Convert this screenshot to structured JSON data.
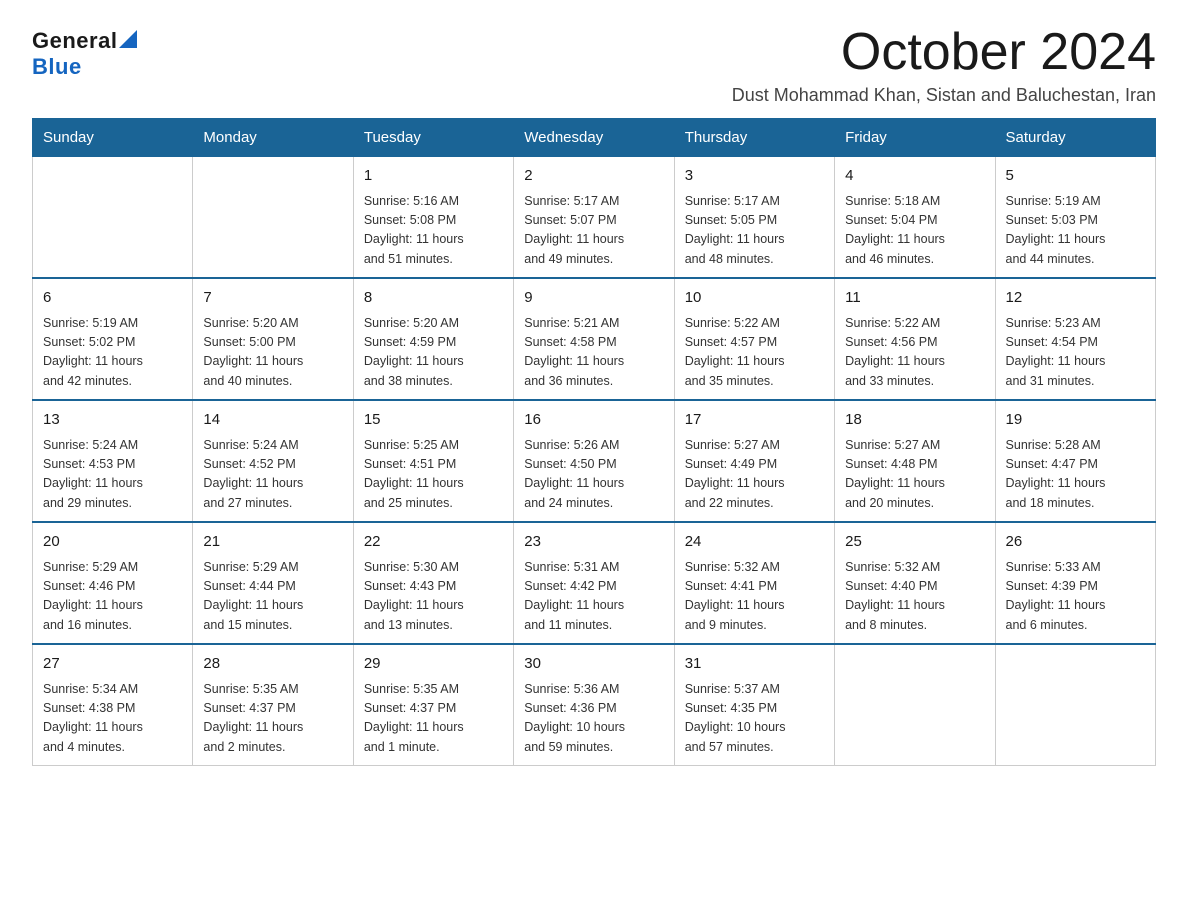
{
  "header": {
    "logo_general": "General",
    "logo_blue": "Blue",
    "month_title": "October 2024",
    "location": "Dust Mohammad Khan, Sistan and Baluchestan, Iran"
  },
  "weekdays": [
    "Sunday",
    "Monday",
    "Tuesday",
    "Wednesday",
    "Thursday",
    "Friday",
    "Saturday"
  ],
  "weeks": [
    [
      {
        "day": "",
        "info": ""
      },
      {
        "day": "",
        "info": ""
      },
      {
        "day": "1",
        "info": "Sunrise: 5:16 AM\nSunset: 5:08 PM\nDaylight: 11 hours\nand 51 minutes."
      },
      {
        "day": "2",
        "info": "Sunrise: 5:17 AM\nSunset: 5:07 PM\nDaylight: 11 hours\nand 49 minutes."
      },
      {
        "day": "3",
        "info": "Sunrise: 5:17 AM\nSunset: 5:05 PM\nDaylight: 11 hours\nand 48 minutes."
      },
      {
        "day": "4",
        "info": "Sunrise: 5:18 AM\nSunset: 5:04 PM\nDaylight: 11 hours\nand 46 minutes."
      },
      {
        "day": "5",
        "info": "Sunrise: 5:19 AM\nSunset: 5:03 PM\nDaylight: 11 hours\nand 44 minutes."
      }
    ],
    [
      {
        "day": "6",
        "info": "Sunrise: 5:19 AM\nSunset: 5:02 PM\nDaylight: 11 hours\nand 42 minutes."
      },
      {
        "day": "7",
        "info": "Sunrise: 5:20 AM\nSunset: 5:00 PM\nDaylight: 11 hours\nand 40 minutes."
      },
      {
        "day": "8",
        "info": "Sunrise: 5:20 AM\nSunset: 4:59 PM\nDaylight: 11 hours\nand 38 minutes."
      },
      {
        "day": "9",
        "info": "Sunrise: 5:21 AM\nSunset: 4:58 PM\nDaylight: 11 hours\nand 36 minutes."
      },
      {
        "day": "10",
        "info": "Sunrise: 5:22 AM\nSunset: 4:57 PM\nDaylight: 11 hours\nand 35 minutes."
      },
      {
        "day": "11",
        "info": "Sunrise: 5:22 AM\nSunset: 4:56 PM\nDaylight: 11 hours\nand 33 minutes."
      },
      {
        "day": "12",
        "info": "Sunrise: 5:23 AM\nSunset: 4:54 PM\nDaylight: 11 hours\nand 31 minutes."
      }
    ],
    [
      {
        "day": "13",
        "info": "Sunrise: 5:24 AM\nSunset: 4:53 PM\nDaylight: 11 hours\nand 29 minutes."
      },
      {
        "day": "14",
        "info": "Sunrise: 5:24 AM\nSunset: 4:52 PM\nDaylight: 11 hours\nand 27 minutes."
      },
      {
        "day": "15",
        "info": "Sunrise: 5:25 AM\nSunset: 4:51 PM\nDaylight: 11 hours\nand 25 minutes."
      },
      {
        "day": "16",
        "info": "Sunrise: 5:26 AM\nSunset: 4:50 PM\nDaylight: 11 hours\nand 24 minutes."
      },
      {
        "day": "17",
        "info": "Sunrise: 5:27 AM\nSunset: 4:49 PM\nDaylight: 11 hours\nand 22 minutes."
      },
      {
        "day": "18",
        "info": "Sunrise: 5:27 AM\nSunset: 4:48 PM\nDaylight: 11 hours\nand 20 minutes."
      },
      {
        "day": "19",
        "info": "Sunrise: 5:28 AM\nSunset: 4:47 PM\nDaylight: 11 hours\nand 18 minutes."
      }
    ],
    [
      {
        "day": "20",
        "info": "Sunrise: 5:29 AM\nSunset: 4:46 PM\nDaylight: 11 hours\nand 16 minutes."
      },
      {
        "day": "21",
        "info": "Sunrise: 5:29 AM\nSunset: 4:44 PM\nDaylight: 11 hours\nand 15 minutes."
      },
      {
        "day": "22",
        "info": "Sunrise: 5:30 AM\nSunset: 4:43 PM\nDaylight: 11 hours\nand 13 minutes."
      },
      {
        "day": "23",
        "info": "Sunrise: 5:31 AM\nSunset: 4:42 PM\nDaylight: 11 hours\nand 11 minutes."
      },
      {
        "day": "24",
        "info": "Sunrise: 5:32 AM\nSunset: 4:41 PM\nDaylight: 11 hours\nand 9 minutes."
      },
      {
        "day": "25",
        "info": "Sunrise: 5:32 AM\nSunset: 4:40 PM\nDaylight: 11 hours\nand 8 minutes."
      },
      {
        "day": "26",
        "info": "Sunrise: 5:33 AM\nSunset: 4:39 PM\nDaylight: 11 hours\nand 6 minutes."
      }
    ],
    [
      {
        "day": "27",
        "info": "Sunrise: 5:34 AM\nSunset: 4:38 PM\nDaylight: 11 hours\nand 4 minutes."
      },
      {
        "day": "28",
        "info": "Sunrise: 5:35 AM\nSunset: 4:37 PM\nDaylight: 11 hours\nand 2 minutes."
      },
      {
        "day": "29",
        "info": "Sunrise: 5:35 AM\nSunset: 4:37 PM\nDaylight: 11 hours\nand 1 minute."
      },
      {
        "day": "30",
        "info": "Sunrise: 5:36 AM\nSunset: 4:36 PM\nDaylight: 10 hours\nand 59 minutes."
      },
      {
        "day": "31",
        "info": "Sunrise: 5:37 AM\nSunset: 4:35 PM\nDaylight: 10 hours\nand 57 minutes."
      },
      {
        "day": "",
        "info": ""
      },
      {
        "day": "",
        "info": ""
      }
    ]
  ]
}
